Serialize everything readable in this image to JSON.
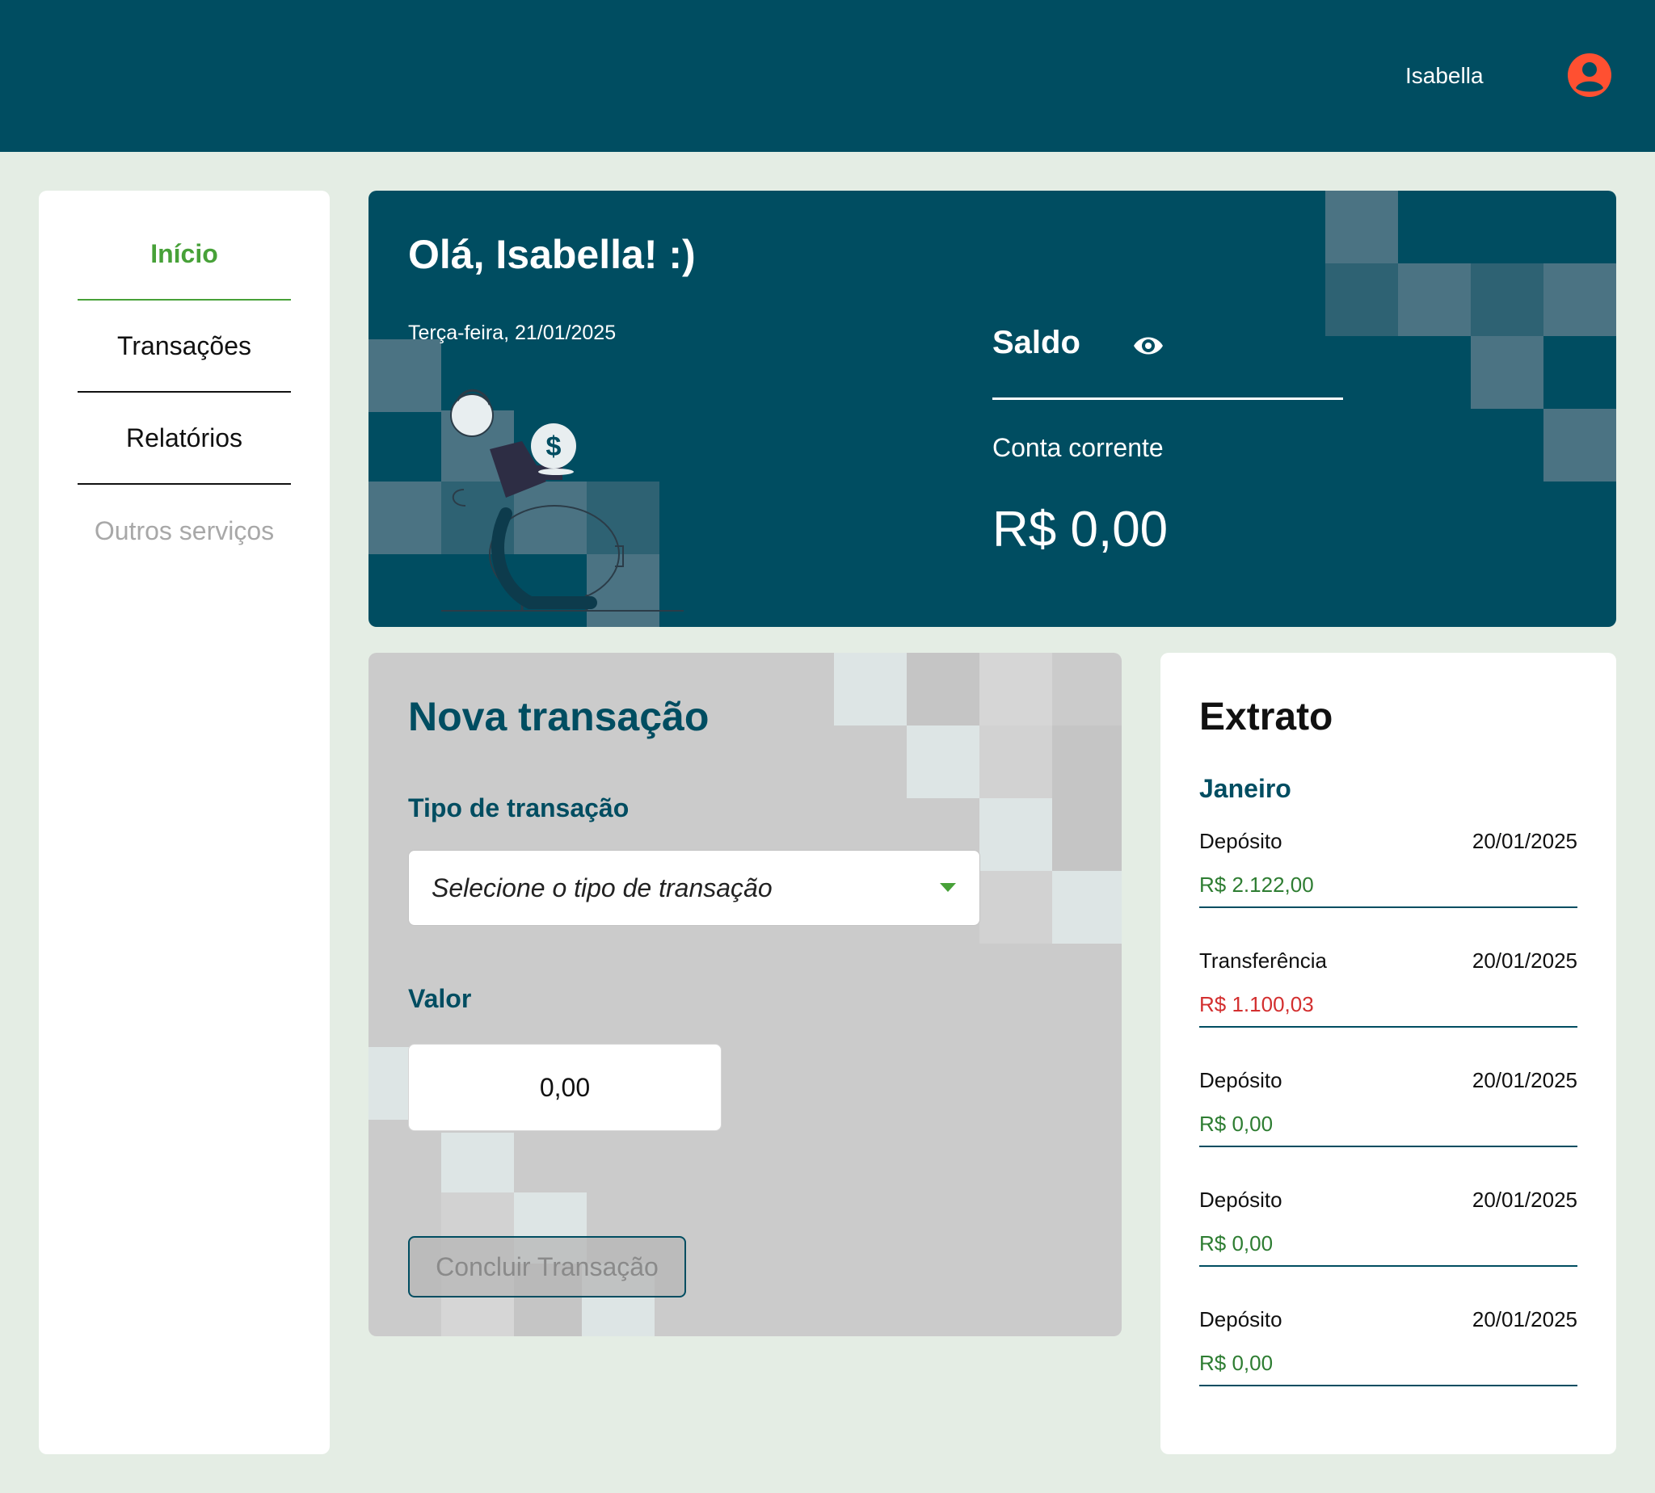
{
  "header": {
    "user_name": "Isabella"
  },
  "sidebar": {
    "items": [
      {
        "label": "Início"
      },
      {
        "label": "Transações"
      },
      {
        "label": "Relatórios"
      },
      {
        "label": "Outros serviços"
      }
    ]
  },
  "hero": {
    "greeting": "Olá, Isabella! :)",
    "date": "Terça-feira, 21/01/2025",
    "saldo_label": "Saldo",
    "account_label": "Conta corrente",
    "balance": "R$ 0,00"
  },
  "new_transaction": {
    "title": "Nova transação",
    "type_label": "Tipo de transação",
    "type_placeholder": "Selecione o tipo de transação",
    "value_label": "Valor",
    "value": "0,00",
    "submit_label": "Concluir Transação"
  },
  "statement": {
    "title": "Extrato",
    "month": "Janeiro",
    "items": [
      {
        "type": "Depósito",
        "date": "20/01/2025",
        "amount": "R$ 2.122,00"
      },
      {
        "type": "Transferência",
        "date": "20/01/2025",
        "amount": "R$ 1.100,03"
      },
      {
        "type": "Depósito",
        "date": "20/01/2025",
        "amount": "R$ 0,00"
      },
      {
        "type": "Depósito",
        "date": "20/01/2025",
        "amount": "R$ 0,00"
      },
      {
        "type": "Depósito",
        "date": "20/01/2025",
        "amount": "R$ 0,00"
      }
    ]
  },
  "colors": {
    "primary": "#004d61",
    "accent_green": "#47a138",
    "positive": "#2e7d32",
    "negative": "#d32f2f",
    "alert_orange": "#ff5031"
  }
}
